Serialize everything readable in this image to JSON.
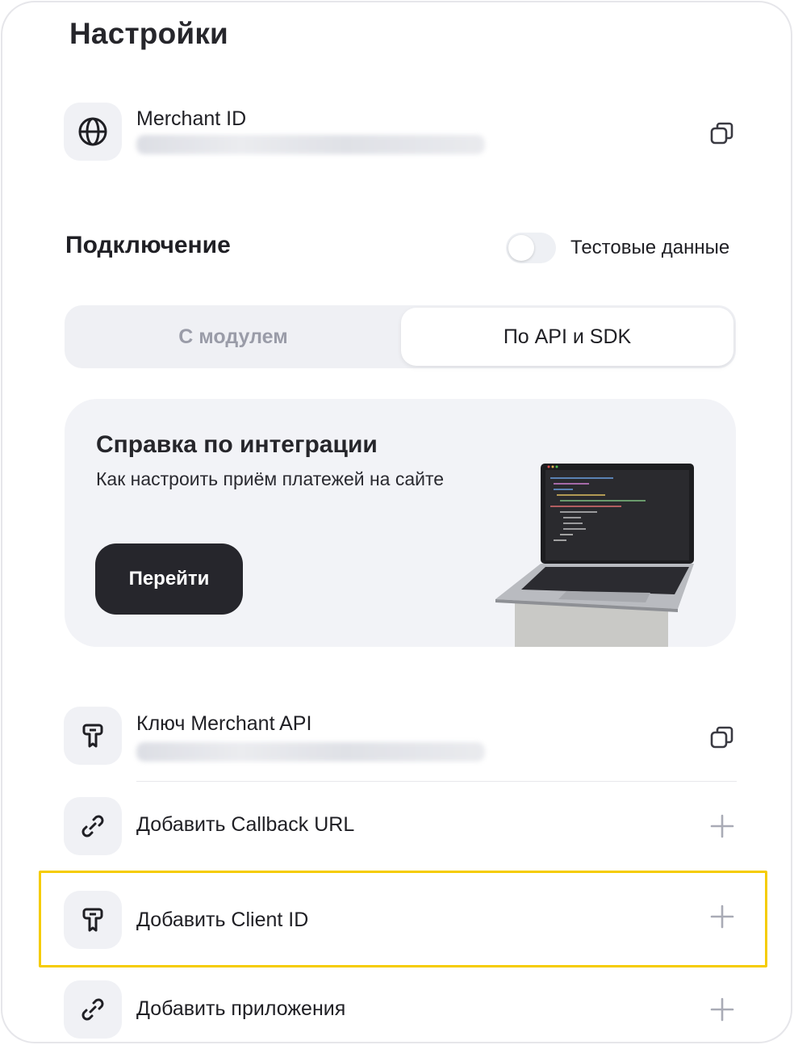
{
  "page": {
    "title": "Настройки"
  },
  "merchant": {
    "label": "Merchant ID",
    "icon": "globe-icon",
    "action_icon": "copy-icon"
  },
  "connection": {
    "title": "Подключение",
    "test_toggle_label": "Тестовые данные",
    "test_toggle_on": false
  },
  "tabs": {
    "module_label": "С модулем",
    "api_label": "По API и SDK",
    "active": "api"
  },
  "help_card": {
    "title": "Справка по интеграции",
    "subtitle": "Как настроить приём платежей на сайте",
    "button_label": "Перейти"
  },
  "items": [
    {
      "label": "Ключ Merchant API",
      "icon": "key-icon",
      "action_icon": "copy-icon"
    },
    {
      "label": "Добавить Callback URL",
      "icon": "link-icon",
      "action_icon": "plus-icon"
    },
    {
      "label": "Добавить Client ID",
      "icon": "key-icon",
      "action_icon": "plus-icon"
    },
    {
      "label": "Добавить приложения",
      "icon": "link-icon",
      "action_icon": "plus-icon"
    }
  ],
  "colors": {
    "highlight": "#f5cc00",
    "button_bg": "#26262c",
    "surface": "#f2f3f7"
  }
}
